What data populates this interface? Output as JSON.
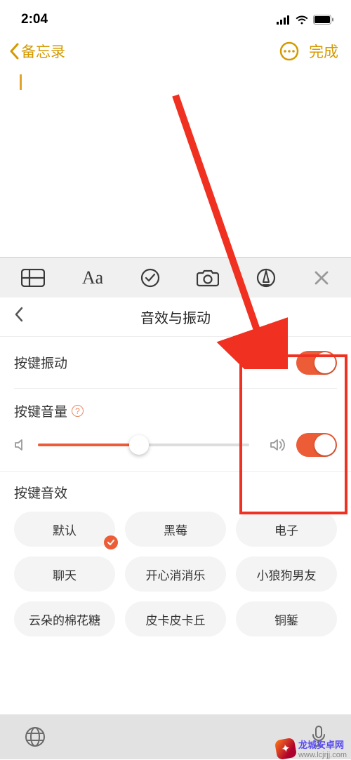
{
  "status": {
    "time": "2:04"
  },
  "nav": {
    "back_label": "备忘录",
    "done_label": "完成"
  },
  "panel": {
    "title": "音效与振动"
  },
  "rows": {
    "vibration_label": "按键振动",
    "volume_label": "按键音量",
    "effects_label": "按键音效"
  },
  "chips": [
    "默认",
    "黑莓",
    "电子",
    "聊天",
    "开心消消乐",
    "小狼狗男友",
    "云朵的棉花糖",
    "皮卡皮卡丘",
    "铜錾"
  ],
  "selected_chip_index": 0,
  "watermark": {
    "brand": "龙城安卓网",
    "url": "www.lcjrjj.com"
  }
}
